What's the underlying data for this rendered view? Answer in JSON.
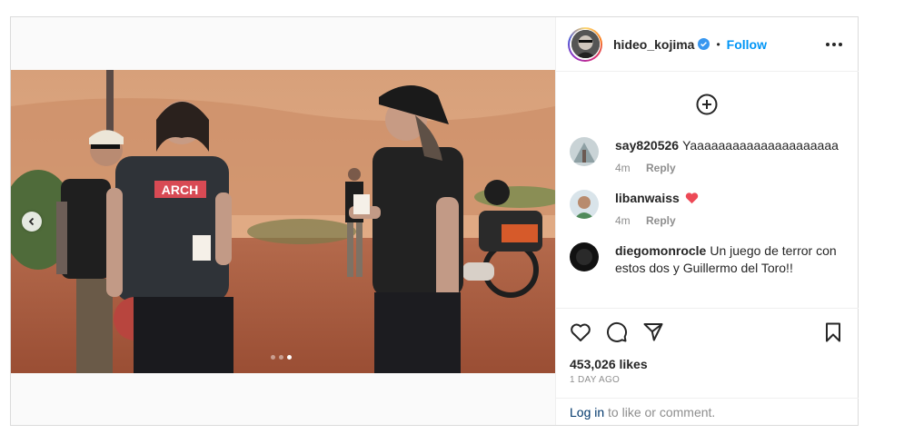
{
  "post": {
    "username": "hideo_kojima",
    "follow_label": "Follow",
    "separator": "•",
    "likes": "453,026 likes",
    "date": "1 DAY AGO"
  },
  "carousel": {
    "dots": 3,
    "active_index": 2
  },
  "comments": [
    {
      "user": "say820526",
      "text": "Yaaaaaaaaaaaaaaaaaaaaa",
      "time": "4m",
      "reply": "Reply"
    },
    {
      "user": "libanwaiss",
      "text": "",
      "emoji": "red-heart-icon",
      "time": "4m",
      "reply": "Reply"
    },
    {
      "user": "diegomonrocle",
      "text": "Un juego de terror con estos dos y Guillermo del Toro!!"
    }
  ],
  "login": {
    "link": "Log in",
    "rest": " to like or comment."
  },
  "colors": {
    "accent": "#0095f6",
    "heart": "#ed4956",
    "verified": "#3897f0"
  }
}
